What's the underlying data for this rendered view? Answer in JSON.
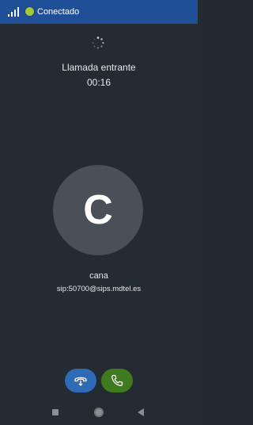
{
  "status_bar": {
    "connection_status": "Conectado",
    "status_color": "#a7c83a",
    "signal_icon": "signal-bars-icon"
  },
  "call": {
    "state": "Llamada entrante",
    "timer": "00:16",
    "loading_icon": "spinner-icon"
  },
  "contact": {
    "initial": "C",
    "name": "cana",
    "uri": "sip:50700@sips.mdtel.es"
  },
  "actions": {
    "transfer_icon": "call-transfer-icon",
    "transfer_color": "#2f6ab4",
    "answer_icon": "phone-icon",
    "answer_color": "#3f7a1f"
  },
  "nav": {
    "recents_icon": "square-icon",
    "home_icon": "circle-icon",
    "back_icon": "triangle-back-icon"
  },
  "colors": {
    "background": "#252b32",
    "status_bar": "#1f4f97"
  }
}
